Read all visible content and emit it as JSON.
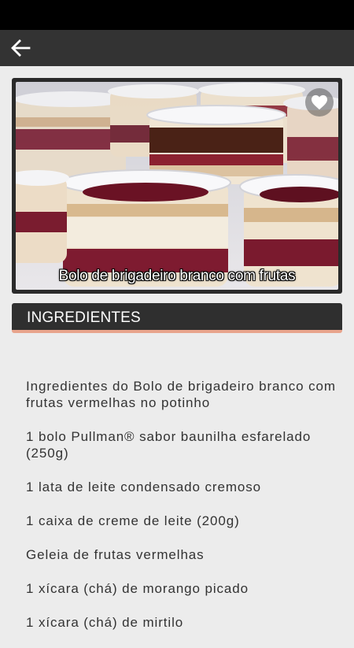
{
  "photo": {
    "caption": "Bolo de brigadeiro branco com frutas"
  },
  "icons": {
    "back": "arrow-left-icon",
    "favorite": "heart-icon"
  },
  "section": {
    "title": "INGREDIENTES"
  },
  "ingredients": [
    "Ingredientes do Bolo de brigadeiro branco com frutas vermelhas no potinho",
    "1 bolo Pullman® sabor baunilha esfarelado (250g)",
    "1 lata de leite condensado cremoso",
    "1 caixa de creme de leite (200g)",
    "Geleia de frutas vermelhas",
    "1 xícara (chá) de morango picado",
    "1 xícara (chá) de mirtilo"
  ],
  "colors": {
    "app_bar": "#333333",
    "section_header": "#2f2f2f",
    "accent_underline": "#e8a48c",
    "background": "#ececec"
  }
}
